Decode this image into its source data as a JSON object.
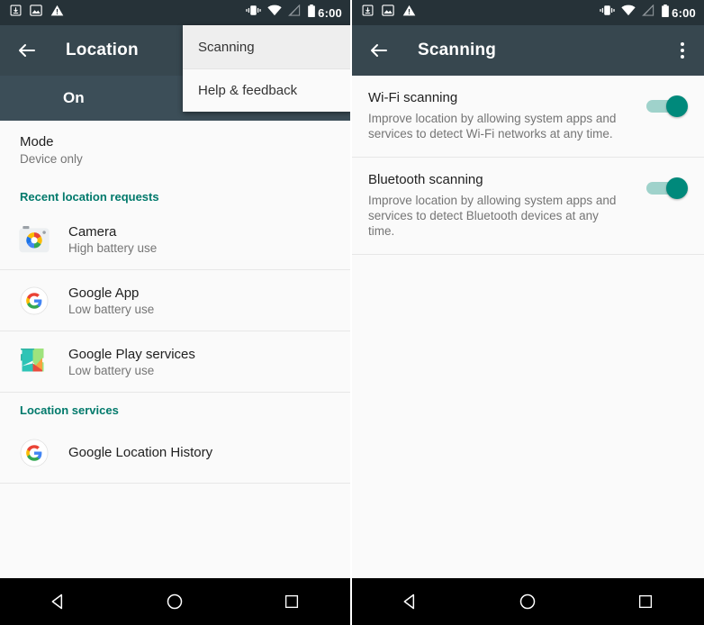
{
  "status_bar": {
    "time": "6:00",
    "left_icons": [
      "download-icon",
      "screenshot-icon",
      "warning-icon"
    ],
    "right_icons": [
      "vibrate-icon",
      "wifi-icon",
      "signal-off-icon",
      "battery-icon"
    ]
  },
  "left_screen": {
    "toolbar": {
      "back_label": "back-arrow",
      "title": "Location"
    },
    "subheader": {
      "label": "On"
    },
    "overflow_menu": {
      "items": [
        {
          "label": "Scanning",
          "highlighted": true
        },
        {
          "label": "Help & feedback",
          "highlighted": false
        }
      ]
    },
    "mode_pref": {
      "title": "Mode",
      "summary": "Device only"
    },
    "recent_requests": {
      "header": "Recent location requests",
      "apps": [
        {
          "name": "Camera",
          "battery": "High battery use",
          "icon": "camera-app-icon"
        },
        {
          "name": "Google App",
          "battery": "Low battery use",
          "icon": "google-g-icon"
        },
        {
          "name": "Google Play services",
          "battery": "Low battery use",
          "icon": "play-services-icon"
        }
      ]
    },
    "location_services": {
      "header": "Location services",
      "items": [
        {
          "name": "Google Location History",
          "icon": "google-g-icon"
        }
      ]
    }
  },
  "right_screen": {
    "toolbar": {
      "title": "Scanning",
      "overflow_label": "more-options"
    },
    "switches": [
      {
        "title": "Wi-Fi scanning",
        "description": "Improve location by allowing system apps and services to detect Wi-Fi networks at any time.",
        "state": "on"
      },
      {
        "title": "Bluetooth scanning",
        "description": "Improve location by allowing system apps and services to detect Bluetooth devices at any time.",
        "state": "on"
      }
    ]
  },
  "nav_bar": {
    "buttons": [
      "back-nav-icon",
      "home-nav-icon",
      "recents-nav-icon"
    ]
  },
  "colors": {
    "toolbar": "#37474F",
    "status_bar": "#263238",
    "subheader": "#3C4E58",
    "accent_teal": "#00796B",
    "switch_on": "#00897B"
  }
}
